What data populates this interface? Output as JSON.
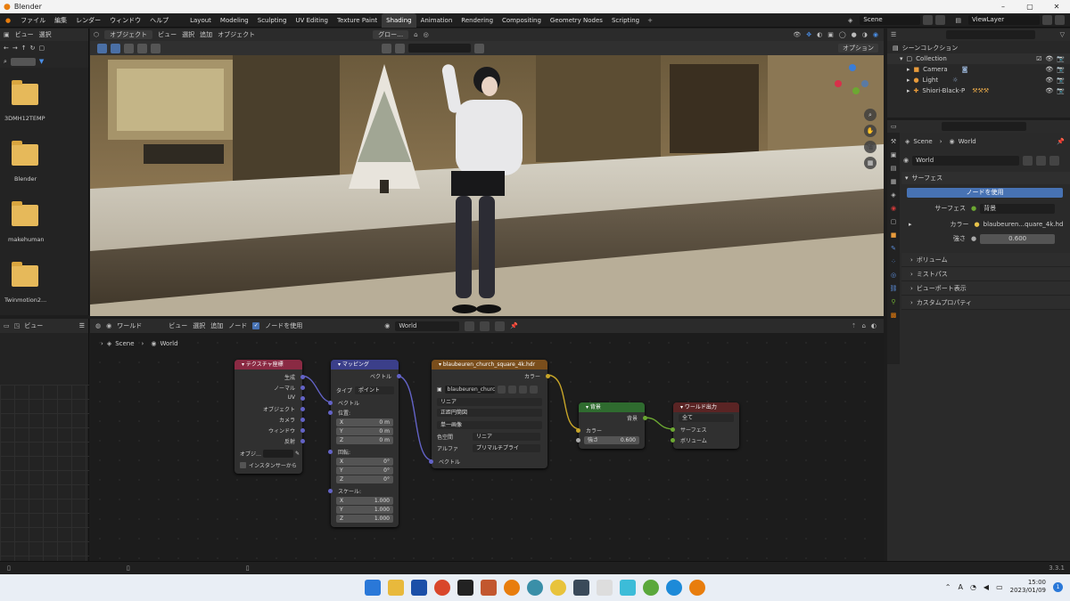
{
  "window": {
    "title": "Blender",
    "min": "–",
    "max": "▢",
    "close": "✕"
  },
  "menu": [
    "ファイル",
    "編集",
    "レンダー",
    "ウィンドウ",
    "ヘルプ"
  ],
  "workspaces": [
    "Layout",
    "Modeling",
    "Sculpting",
    "UV Editing",
    "Texture Paint",
    "Shading",
    "Animation",
    "Rendering",
    "Compositing",
    "Geometry Nodes",
    "Scripting"
  ],
  "active_workspace": "Shading",
  "scene_name": "Scene",
  "view_layer": "ViewLayer",
  "file_browser": {
    "view": "ビュー",
    "select": "選択",
    "folders": [
      "3DMH12TEMP",
      "Blender",
      "makehuman",
      "Twinmotion2..."
    ]
  },
  "viewport": {
    "mode": "オブジェクト",
    "menus": [
      "ビュー",
      "選択",
      "追加",
      "オブジェクト"
    ],
    "global": "グロー…",
    "options": "オプション"
  },
  "outliner": {
    "root": "シーンコレクション",
    "collection": "Collection",
    "items": [
      "Camera",
      "Light",
      "Shiori-Black-P"
    ]
  },
  "properties": {
    "breadcrumb_scene": "Scene",
    "breadcrumb_world": "World",
    "world_name": "World",
    "surface_header": "サーフェス",
    "use_nodes": "ノードを使用",
    "surface_label": "サーフェス",
    "surface_value": "背景",
    "color_label": "カラー",
    "color_value": "blaubeuren...quare_4k.hd",
    "strength_label": "強さ",
    "strength_value": "0.600",
    "panels": [
      "ボリューム",
      "ミストパス",
      "ビューポート表示",
      "カスタムプロパティ"
    ]
  },
  "node_editor": {
    "type": "ワールド",
    "menus": [
      "ビュー",
      "選択",
      "追加",
      "ノード"
    ],
    "use_nodes": "ノードを使用",
    "world": "World",
    "breadcrumb_scene": "Scene",
    "breadcrumb_world": "World",
    "left_view": "ビュー"
  },
  "nodes": {
    "texcoord": {
      "title": "テクスチャ座標",
      "outputs": [
        "生成",
        "ノーマル",
        "UV",
        "オブジェクト",
        "カメラ",
        "ウィンドウ",
        "反射"
      ],
      "object_label": "オブジ…",
      "instancer": "インスタンサーから"
    },
    "mapping": {
      "title": "マッピング",
      "out": "ベクトル",
      "type_label": "タイプ",
      "type_value": "ポイント",
      "vector": "ベクトル",
      "location": "位置:",
      "loc": [
        "0 m",
        "0 m",
        "0 m"
      ],
      "rotation": "回転:",
      "rot": [
        "0°",
        "0°",
        "0°"
      ],
      "scale": "スケール:",
      "scl": [
        "1.000",
        "1.000",
        "1.000"
      ],
      "axes": [
        "X",
        "Y",
        "Z"
      ]
    },
    "envtex": {
      "title": "blaubeuren_church_square_4k.hdr",
      "out": "カラー",
      "image": "blaubeuren_church...",
      "interp": "リニア",
      "proj": "正距円筒図",
      "single": "単一画像",
      "colorspace_label": "色空間",
      "colorspace": "リニア",
      "alpha_label": "アルファ",
      "alpha": "プリマルチプライ",
      "vector": "ベクトル"
    },
    "background": {
      "title": "背景",
      "out": "背景",
      "color": "カラー",
      "strength_label": "強さ",
      "strength": "0.600"
    },
    "output": {
      "title": "ワールド出力",
      "target": "全て",
      "surface": "サーフェス",
      "volume": "ボリューム"
    }
  },
  "status": {
    "version": "3.3.1"
  },
  "taskbar": {
    "time": "15:00",
    "date": "2023/01/09",
    "ime": "A",
    "notif": "1"
  }
}
